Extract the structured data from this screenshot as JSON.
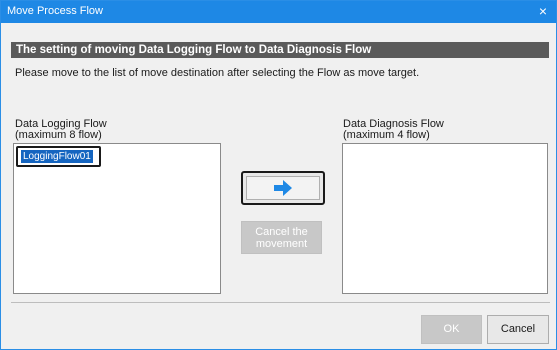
{
  "window": {
    "title": "Move Process Flow",
    "close_glyph": "×"
  },
  "header": {
    "text": "The setting of moving Data Logging Flow to Data Diagnosis Flow"
  },
  "instruction": "Please move to the list of move destination after selecting the Flow as move target.",
  "left_list": {
    "label_line1": "Data Logging Flow",
    "label_line2": "(maximum 8 flow)",
    "items": [
      {
        "label": "LoggingFlow01",
        "selected": true
      }
    ]
  },
  "right_list": {
    "label_line1": "Data Diagnosis Flow",
    "label_line2": "(maximum 4 flow)",
    "items": []
  },
  "buttons": {
    "move_icon": "right-arrow-icon",
    "cancel_movement_line1": "Cancel the",
    "cancel_movement_line2": "movement",
    "ok": "OK",
    "cancel": "Cancel"
  },
  "colors": {
    "titlebar": "#1e88e5",
    "header_bar": "#5a5a5a",
    "selection": "#1565c0",
    "arrow": "#1e88e5"
  }
}
